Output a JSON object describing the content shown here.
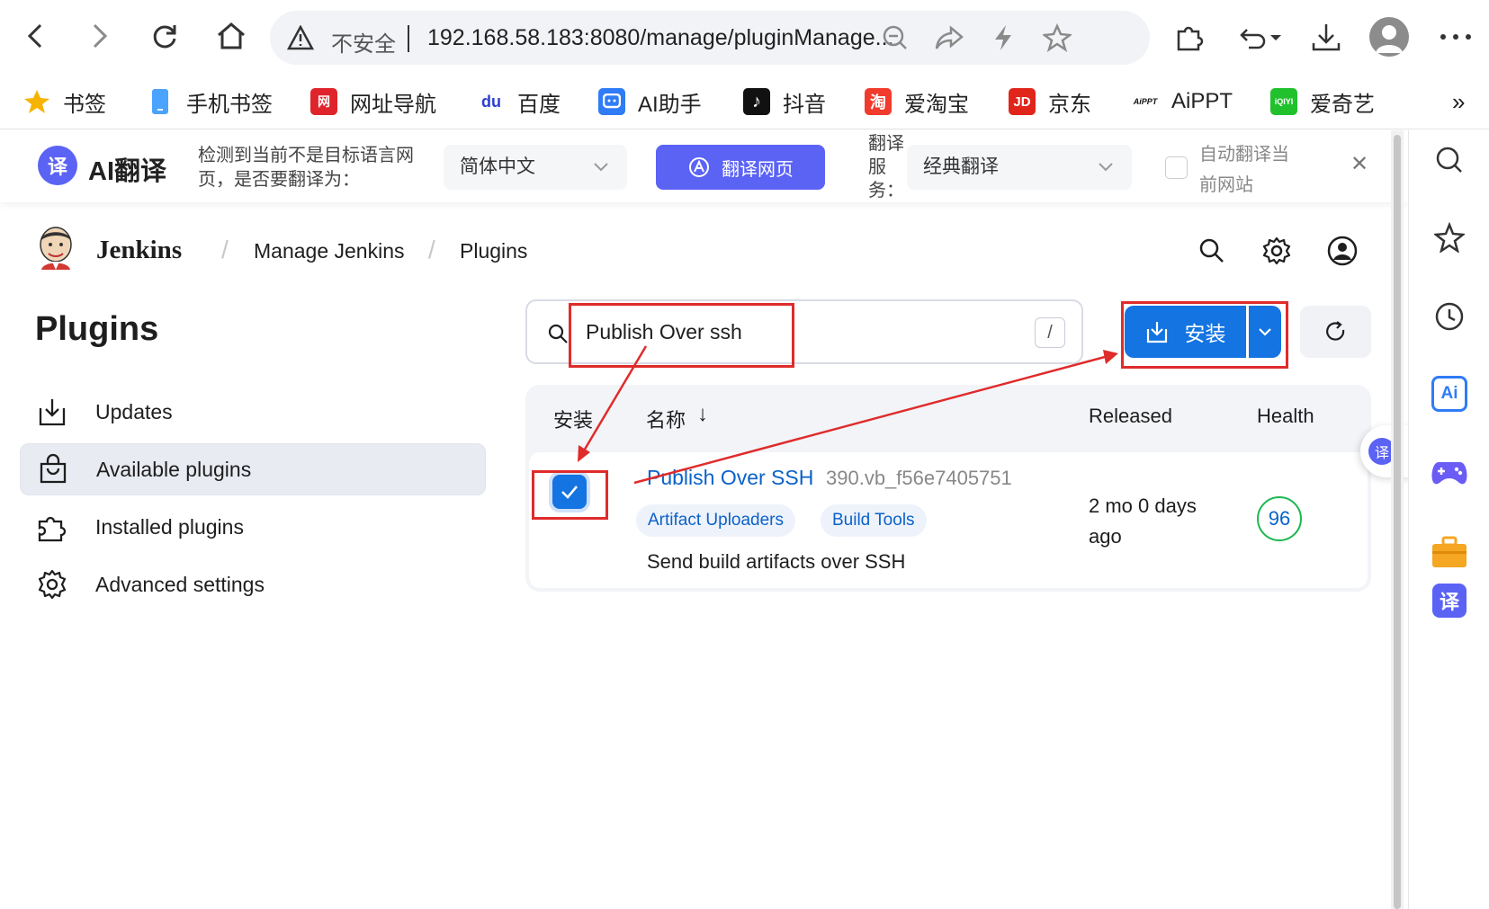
{
  "browser": {
    "url_warning": "不安全",
    "url": "192.168.58.183:8080/manage/pluginManage...",
    "bookmarks": [
      {
        "label": "书签",
        "icon": "star-icon",
        "color": "#f6b400"
      },
      {
        "label": "手机书签",
        "icon": "phone-icon",
        "color": "#4aa3ff"
      },
      {
        "label": "网址导航",
        "icon": "nav-icon",
        "color": "#e0242b"
      },
      {
        "label": "百度",
        "icon": "baidu-icon",
        "color": "#2e3fd1"
      },
      {
        "label": "AI助手",
        "icon": "ai-assistant-icon",
        "color": "#2f7cf6"
      },
      {
        "label": "抖音",
        "icon": "douyin-icon",
        "color": "#111111"
      },
      {
        "label": "爱淘宝",
        "icon": "taobao-icon",
        "color": "#f13b2d"
      },
      {
        "label": "京东",
        "icon": "jd-icon",
        "color": "#e1251b"
      },
      {
        "label": "AiPPT",
        "icon": "aippt-icon",
        "color": "#111111"
      },
      {
        "label": "爱奇艺",
        "icon": "iqiyi-icon",
        "color": "#20c12d"
      }
    ],
    "bookmark_glyphs": {
      "nav": "网",
      "baidu": "du",
      "douyin": "♪",
      "taobao": "淘",
      "jd": "JD",
      "aippt": "AiPPT",
      "iqiyi": "iQIYI"
    },
    "more_bookmarks": "»"
  },
  "translate_bar": {
    "brand": "AI翻译",
    "brand_icon_glyph": "译",
    "prompt": [
      "检测到当前不是目标语言网",
      "页，是否要翻译为："
    ],
    "target_language": "简体中文",
    "translate_button": "翻译网页",
    "service_label": [
      "翻译",
      "服",
      "务："
    ],
    "service_value": "经典翻译",
    "auto_label": [
      "自动翻译当",
      "前网站"
    ],
    "close": "✕"
  },
  "jenkins": {
    "brand": "Jenkins",
    "breadcrumb": [
      "Manage Jenkins",
      "Plugins"
    ],
    "breadcrumb_sep": "/",
    "page_title": "Plugins",
    "side_nav": [
      {
        "label": "Updates",
        "icon": "download-icon"
      },
      {
        "label": "Available plugins",
        "icon": "shopping-bag-icon",
        "active": true
      },
      {
        "label": "Installed plugins",
        "icon": "puzzle-icon"
      },
      {
        "label": "Advanced settings",
        "icon": "gear-icon"
      }
    ],
    "search": {
      "value": "Publish Over ssh",
      "shortcut": "/"
    },
    "install_button": "安装",
    "columns": {
      "install": "安装",
      "name": "名称",
      "sort_arrow": "↓",
      "released": "Released",
      "health": "Health"
    },
    "plugin": {
      "name": "Publish Over SSH",
      "version": "390.vb_f56e7405751",
      "tags": [
        "Artifact Uploaders",
        "Build Tools"
      ],
      "description": "Send build artifacts over SSH",
      "released": [
        "2 mo 0 days",
        "ago"
      ],
      "health": "96",
      "checked": true
    }
  },
  "floating_translate_glyph": "译",
  "right_sidebar": {
    "ai_glyph": "Ai",
    "translate_glyph": "译",
    "icons": [
      "search-icon",
      "favorites-icon",
      "history-icon",
      "ai-icon",
      "game-icon",
      "toolbox-icon",
      "translate-icon"
    ]
  },
  "colors": {
    "accent": "#1374e2",
    "annotation": "#e02b2b",
    "health": "#1cb84f",
    "translate_accent": "#5b63f5"
  }
}
